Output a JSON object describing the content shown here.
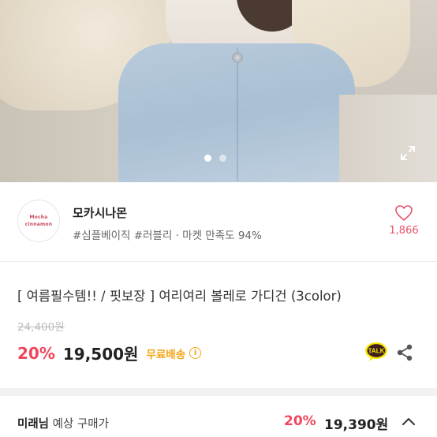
{
  "gallery": {
    "pages": [
      "1",
      "2"
    ],
    "active_page": 1,
    "expand_icon": "expand-icon"
  },
  "shop": {
    "name": "모카시나몬",
    "logo_text": [
      "Mocha",
      "cinnamon"
    ],
    "tags": "#심플베이직 #러블리 · 마켓 만족도 94%",
    "likes": "1,866",
    "like_icon": "heart-icon"
  },
  "product": {
    "title": "[ 여름필수템!! / 핏보장 ] 여리여리 볼레로 가디건 (3color)",
    "original_price": "24,400원",
    "discount": "20%",
    "price": "19,500원",
    "free_shipping": "무료배송",
    "info_icon": "ⓘ",
    "talk_label": "TALK"
  },
  "expected_buyer": {
    "name": "미래님",
    "label": "예상 구매가",
    "discount": "20%",
    "price": "19,390원"
  },
  "colors": {
    "accent": "#f0465c",
    "heart": "#e5536b",
    "shipping": "#f3a40f",
    "kakao": "#3c1e1e"
  }
}
